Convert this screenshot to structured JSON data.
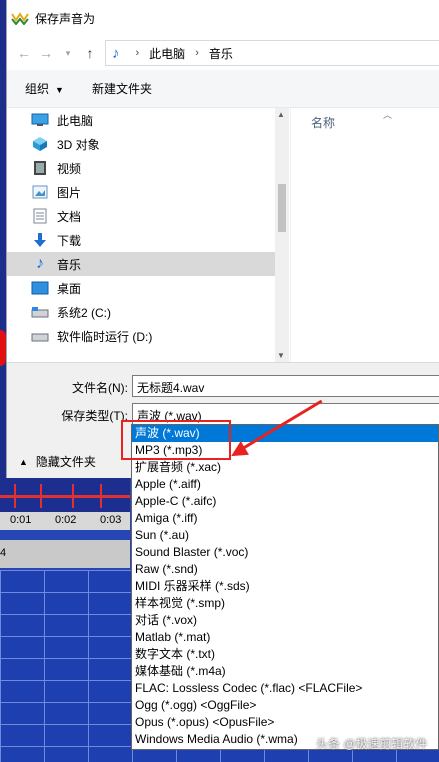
{
  "dialog": {
    "title": "保存声音为",
    "breadcrumb": [
      "此电脑",
      "音乐"
    ],
    "toolbar": {
      "organize": "组织",
      "new_folder": "新建文件夹"
    },
    "nav_items": [
      {
        "label": "此电脑",
        "icon": "computer-icon"
      },
      {
        "label": "3D 对象",
        "icon": "cube-icon"
      },
      {
        "label": "视频",
        "icon": "video-icon"
      },
      {
        "label": "图片",
        "icon": "picture-icon"
      },
      {
        "label": "文档",
        "icon": "document-icon"
      },
      {
        "label": "下载",
        "icon": "download-icon"
      },
      {
        "label": "音乐",
        "icon": "music-icon",
        "selected": true
      },
      {
        "label": "桌面",
        "icon": "desktop-icon"
      },
      {
        "label": "系统2 (C:)",
        "icon": "drive-icon"
      },
      {
        "label": "软件临时运行 (D:)",
        "icon": "drive-icon"
      }
    ],
    "column_name": "名称",
    "filename_label": "文件名(N):",
    "filename_value": "无标题4.wav",
    "type_label": "保存类型(T):",
    "type_value": "声波 (*.wav)",
    "hide_folders": "隐藏文件夹"
  },
  "dropdown_options": [
    "声波 (*.wav)",
    "MP3 (*.mp3)",
    "扩展音频 (*.xac)",
    "Apple (*.aiff)",
    "Apple-C (*.aifc)",
    "Amiga (*.iff)",
    "Sun (*.au)",
    "Sound Blaster (*.voc)",
    "Raw (*.snd)",
    "MIDI 乐器采样 (*.sds)",
    "样本视觉 (*.smp)",
    "对话 (*.vox)",
    "Matlab (*.mat)",
    "数字文本 (*.txt)",
    "媒体基础 (*.m4a)",
    "FLAC: Lossless Codec (*.flac)    <FLACFile>",
    "Ogg (*.ogg)    <OggFile>",
    "Opus (*.opus)    <OpusFile>",
    "Windows Media Audio (*.wma)"
  ],
  "dropdown_selected": "声波 (*.wav)",
  "background": {
    "times": [
      "0:01",
      "0:02",
      "0:03"
    ],
    "side_label": "4"
  },
  "watermark": "头条 @极速剪辑软件",
  "colors": {
    "selection": "#0078d7",
    "annotation": "#e8231f",
    "waveform_bg": "#2646b5"
  }
}
